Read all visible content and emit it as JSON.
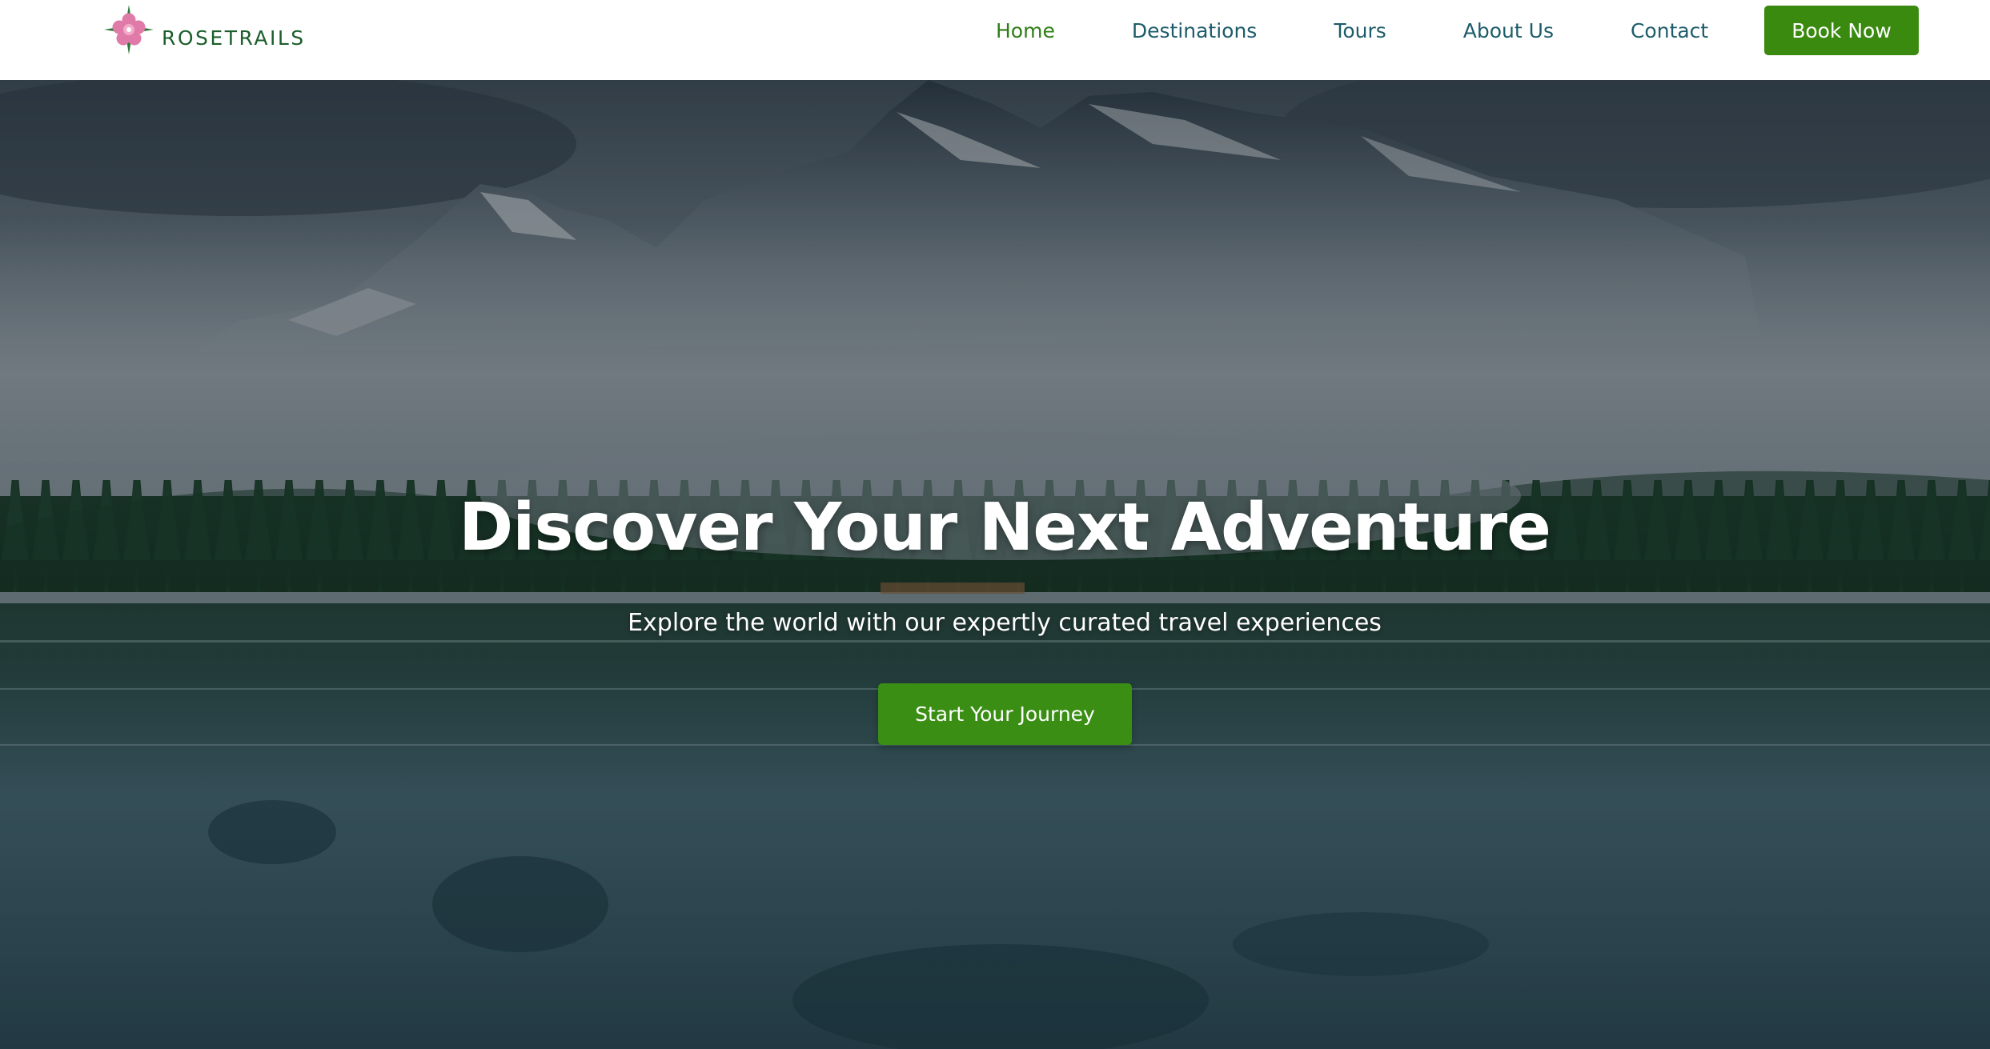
{
  "brand": {
    "name": "ROSETRAILS",
    "logo_icon": "compass-rose-flower-icon",
    "colors": {
      "logo_text": "#1c5e2c",
      "petal": "#e07aa8",
      "leaf": "#2c7a3a"
    }
  },
  "nav": {
    "items": [
      {
        "label": "Home",
        "active": true
      },
      {
        "label": "Destinations",
        "active": false
      },
      {
        "label": "Tours",
        "active": false
      },
      {
        "label": "About Us",
        "active": false
      },
      {
        "label": "Contact",
        "active": false
      }
    ],
    "cta_label": "Book Now",
    "colors": {
      "link": "#1d5c6a",
      "active_link": "#2f7d16",
      "button": "#3a8a10"
    }
  },
  "hero": {
    "title": "Discover Your Next Adventure",
    "subtitle": "Explore the world with our expertly curated travel experiences",
    "cta_label": "Start Your Journey",
    "background": "misty-mountain-lake-forest-image",
    "colors": {
      "button": "#3a8e14",
      "text": "#ffffff"
    }
  }
}
